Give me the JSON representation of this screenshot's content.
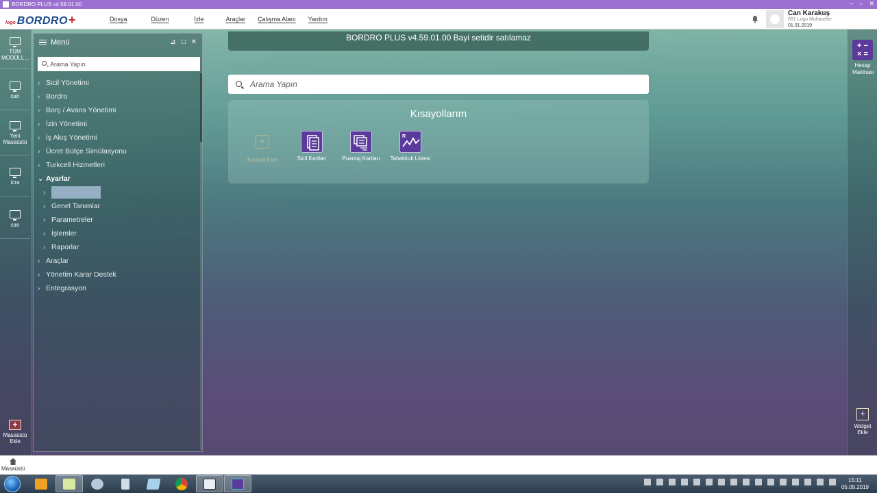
{
  "window": {
    "title": "BORDRO PLUS v4.59.01.00"
  },
  "logo": {
    "small": "logo",
    "big": "BORDRO",
    "plus": "+"
  },
  "menubar": {
    "items": [
      "Dosya",
      "Düzen",
      "İzle",
      "Araçlar",
      "Çalışma Alanı",
      "Yardım"
    ]
  },
  "user": {
    "name": "Can Karakuş",
    "company": "001 Logo Muhasebe",
    "date": "01.01.2019"
  },
  "left_dock": {
    "items": [
      "TÜM MODÜLL...",
      "can",
      "Yeni Masaüstü",
      "icra",
      "can"
    ],
    "add_label": "Masaüstü Ekle"
  },
  "menu_panel": {
    "title": "Menü",
    "search_placeholder": "Arama Yapın",
    "items": [
      {
        "label": "Sicil Yönetimi"
      },
      {
        "label": "Bordro"
      },
      {
        "label": "Borç / Avans Yönetimi"
      },
      {
        "label": "İzin Yönetimi"
      },
      {
        "label": "İş Akış Yönetimi"
      },
      {
        "label": "Ücret Bütçe Simülasyonu"
      },
      {
        "label": "Turkcell Hizmetleri"
      },
      {
        "label": "Ayarlar"
      }
    ],
    "sub_items": [
      "Genel Tanımlar",
      "Parametreler",
      "İşlemler",
      "Raporlar"
    ],
    "items_after": [
      "Araçlar",
      "Yönetim Karar Destek",
      "Entegrasyon"
    ]
  },
  "banner": {
    "text": "BORDRO PLUS v4.59.01.00 Bayi setidir satılamaz"
  },
  "main_search": {
    "placeholder": "Arama Yapın"
  },
  "shortcuts": {
    "title": "Kısayollarım",
    "add_label": "Kısayol Ekle",
    "items": [
      {
        "label": "Sicil Kartları",
        "icon": "document-icon"
      },
      {
        "label": "Puantaj Kartları",
        "icon": "timesheet-icon"
      },
      {
        "label": "Tahakkuk Listesi",
        "icon": "chart-icon"
      }
    ]
  },
  "right_dock": {
    "calc_label": "Hesap Makinası",
    "widget_label": "Widget Ekle"
  },
  "bottom_bar": {
    "home_label": "Masaüstü"
  },
  "taskbar": {
    "time": "15:11",
    "date": "05.09.2019"
  }
}
